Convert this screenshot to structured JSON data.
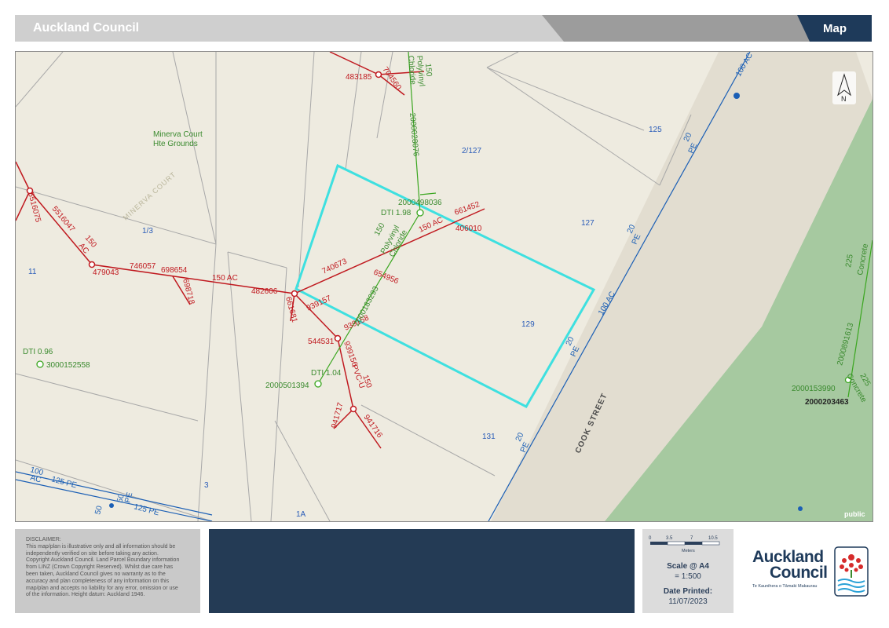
{
  "header": {
    "title": "Auckland Council",
    "section": "Map"
  },
  "map": {
    "place_names": {
      "minerva_court_grounds_1": "Minerva Court",
      "minerva_court_grounds_2": "Hte Grounds",
      "minerva_court_road": "MINERVA COURT",
      "cook_street": "COOK STREET"
    },
    "parcel_labels": {
      "p125": "125",
      "p2_127": "2/127",
      "p127": "127",
      "p129": "129",
      "p131": "131",
      "p1_3": "1/3",
      "p11": "11",
      "p3": "3",
      "p1a": "1A"
    },
    "wastewater_labels": {
      "n483185": "483185",
      "n704560": "704560",
      "n5516075": "5516075",
      "n5516047": "5516047",
      "ac150a": "150",
      "ac150a2": "AC",
      "n479043": "479043",
      "n746057": "746057",
      "n698654": "698654",
      "n698718": "698718",
      "ac150b": "150 AC",
      "n482606": "482606",
      "n661681": "661681",
      "n740673": "740673",
      "n654956": "654956",
      "ac150c": "150 AC",
      "n661452": "661452",
      "n406010": "406010",
      "n939157": "939157",
      "n939158": "939158",
      "n544531": "544531",
      "n939156": "939156",
      "pvcu": "PVC-U",
      "pvcu150": "150",
      "n941717": "941717",
      "n941716": "941716"
    },
    "water_labels": {
      "w150a": "150",
      "w_poly_a1": "Polyvinyl",
      "w_poly_a2": "Chloride",
      "w2000028076": "2000028076",
      "w2000498036": "2000498036",
      "dti198": "DTI 1.98",
      "w150b": "150",
      "w_poly_b1": "Polyvinyl",
      "w_poly_b2": "Chloride",
      "w2000183293": "2000183293",
      "dti104": "DTI 1.04",
      "w2000501394": "2000501394",
      "dti096": "DTI 0.96",
      "w3000152558": "3000152558",
      "w2000153990": "2000153990",
      "w2000203463": "2000203463",
      "c225a": "225",
      "c_concrete_a": "Concrete",
      "w2000891613": "2000891613",
      "c225b": "225",
      "c_concrete_b": "Concrete"
    },
    "main_labels": {
      "ac100a": "100 AC",
      "ac100b": "100 AC",
      "pe20a": "20",
      "pe20a2": "PE",
      "pe20b": "20",
      "pe20b2": "PE",
      "pe20c": "20",
      "pe20c2": "PE",
      "pe20d": "20",
      "pe20d2": "PE",
      "ac100c": "100",
      "ac100c2": "AC",
      "pe125a": "125 PE",
      "pe125b": "125 PE",
      "pe50a": "50",
      "pe50b": "50",
      "pe50c": "PE"
    },
    "north_label": "N",
    "watermark": "public",
    "colors": {
      "parcel_highlight": "#3ee0e0",
      "wastewater": "#c0191f",
      "water": "#3aa61f",
      "watermain": "#1b5fb5",
      "park": "#a6c9a0"
    }
  },
  "disclaimer": {
    "lines": [
      "DISCLAIMER:",
      "This map/plan is illustrative only and all information should be",
      "independently verified on site before taking any action.",
      "Copyright Auckland Council.  Land Parcel Boundary information",
      "from LINZ (Crown Copyright Reserved). Whilst due care has",
      "been taken, Auckland Council gives no warranty as to the",
      "accuracy and plan completeness of any information on this",
      "map/plan and accepts no liability for any error, omission or use",
      "of the information. Height datum: Auckland 1946."
    ]
  },
  "scale": {
    "ticks": [
      "0",
      "3.5",
      "7",
      "10.5"
    ],
    "unit": "Meters",
    "scale_title": "Scale @ A4",
    "scale_value": "= 1:500",
    "date_title": "Date Printed:",
    "date_value": "11/07/2023"
  },
  "logo": {
    "line1": "Auckland",
    "line2": "Council",
    "tagline": "Te Kaunihera o Tāmaki Makaurau"
  }
}
